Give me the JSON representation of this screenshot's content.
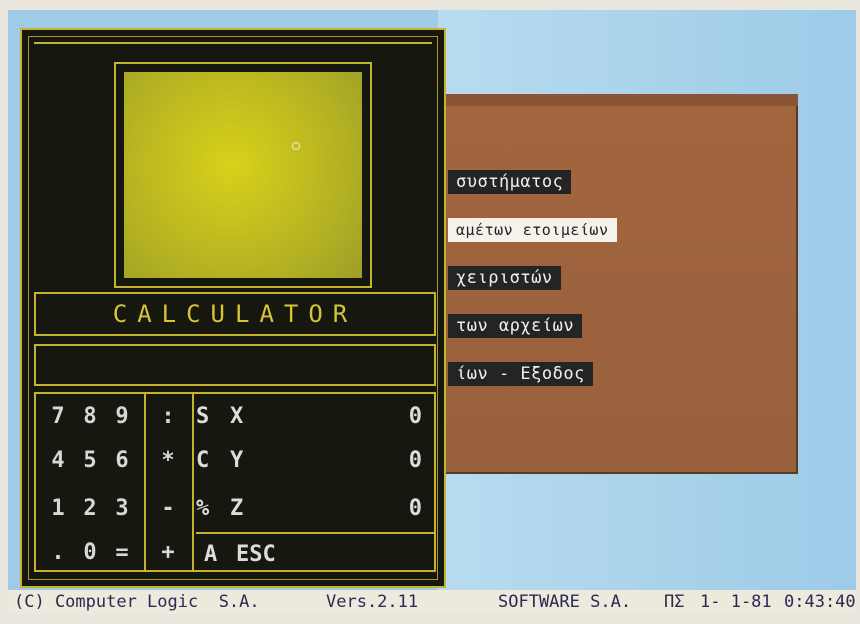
{
  "calculator": {
    "title": "CALCULATOR",
    "keys": {
      "row1": [
        "7",
        "8",
        "9",
        ":"
      ],
      "row2": [
        "4",
        "5",
        "6",
        "*"
      ],
      "row3": [
        "1",
        "2",
        "3",
        "-"
      ],
      "row4": [
        ".",
        "0",
        "=",
        "+"
      ]
    },
    "registers": [
      {
        "op": "S",
        "name": "X",
        "value": "0"
      },
      {
        "op": "C",
        "name": "Y",
        "value": "0"
      },
      {
        "op": "%",
        "name": "Z",
        "value": "0"
      }
    ],
    "esc_op": "A",
    "esc_label": "ESC"
  },
  "menu": {
    "items": [
      {
        "label": "συστήματος"
      },
      {
        "label": "αμέτων ετοιμείων",
        "selected": true
      },
      {
        "label": "χειριστών"
      },
      {
        "label": "των αρχείων"
      },
      {
        "label": "ίων - Εξοδος"
      }
    ]
  },
  "status_bar": {
    "copyright": "(C) Computer Logic  S.A.",
    "version": "Vers.2.11",
    "company": "SOFTWARE S.A.",
    "day": "ΠΣ",
    "date": "1- 1-81",
    "time": "0:43:40"
  },
  "colors": {
    "calc_border": "#c5b32d",
    "calc_background": "#16170f",
    "display": "#c8c422",
    "menu_background": "#a3663e",
    "desktop": "#9fcbe6"
  }
}
